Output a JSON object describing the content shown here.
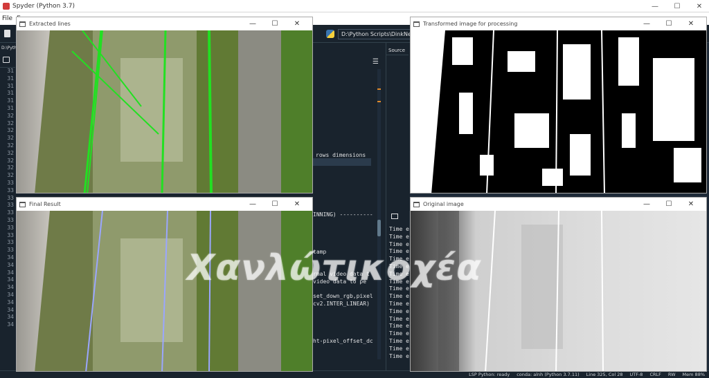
{
  "app": {
    "title": "Spyder (Python 3.7)",
    "menu": [
      "File",
      "E"
    ],
    "path_box": "D:\\Python Scripts\\DinkNet",
    "left_path": "D:\\Pyth",
    "source_tab": "Source",
    "line_numbers": [
      "31",
      "31",
      "31",
      "31",
      "31",
      "31",
      "32",
      "32",
      "32",
      "32",
      "32",
      "32",
      "32",
      "32",
      "32",
      "33",
      "33",
      "33",
      "33",
      "33",
      "33",
      "33",
      "33",
      "33",
      "33",
      "34",
      "34",
      "34",
      "34",
      "34",
      "34",
      "34",
      "34",
      "34",
      "34"
    ],
    "code_lines": [
      {
        "text": "rows dimensions",
        "highlight": true
      },
      {
        "text": "INNING) ----------"
      },
      {
        "text": "tamp"
      },
      {
        "text": "rmal video data t"
      },
      {
        "text": "video data to pe"
      },
      {
        "text": "set_down_rgb,pixel"
      },
      {
        "text": "cv2.INTER_LINEAR)"
      },
      {
        "text": "ht-pixel_offset_dc"
      }
    ],
    "console_lines": [
      "Time e",
      "Time e",
      "Time e",
      "Time e",
      "Time e",
      "Time e",
      "Time e",
      "Time e",
      "Time e",
      "Time e",
      "Time e",
      "Time e",
      "Time e",
      "Time e",
      "Time e",
      "Time e",
      "Time e",
      "Time e"
    ],
    "status": [
      "LSP Python: ready",
      "conda: alnh (Python 3.7.11)",
      "Line 325, Col 28",
      "UTF-8",
      "CRLF",
      "RW",
      "Mem 88%"
    ]
  },
  "windows": {
    "extracted_lines": {
      "title": "Extracted lines"
    },
    "transformed": {
      "title": "Transformed image for processing"
    },
    "final_result": {
      "title": "Final Result"
    },
    "original": {
      "title": "Original image"
    }
  },
  "window_controls": {
    "minimize": "—",
    "maximize": "☐",
    "close": "✕"
  },
  "watermark": "Χανλώτικοχέα",
  "colors": {
    "spyder_bg": "#19232d",
    "detected_line": "#22e022",
    "final_line": "#9aa6ff",
    "code_text": "#e0e1e3"
  }
}
